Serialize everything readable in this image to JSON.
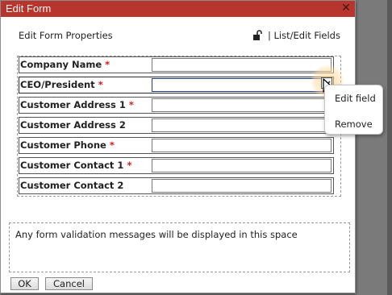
{
  "window": {
    "title": "Edit Form",
    "close_icon": "close-icon"
  },
  "header": {
    "properties_label": "Edit Form Properties",
    "lock_icon": "unlocked-padlock-icon",
    "list_edit_label": "| List/Edit Fields"
  },
  "fields": [
    {
      "label": "Company Name",
      "required": "*",
      "value": ""
    },
    {
      "label": "CEO/President",
      "required": "*",
      "value": "",
      "selected": true
    },
    {
      "label": "Customer Address 1",
      "required": "*",
      "value": ""
    },
    {
      "label": "Customer Address 2",
      "required": "",
      "value": ""
    },
    {
      "label": "Customer Phone",
      "required": "*",
      "value": ""
    },
    {
      "label": "Customer Contact 1",
      "required": "*",
      "value": ""
    },
    {
      "label": "Customer Contact 2",
      "required": "",
      "value": ""
    }
  ],
  "context_menu": {
    "items": [
      "Edit field",
      "Remove"
    ]
  },
  "validation": {
    "message": "Any form validation messages will be displayed in this space"
  },
  "buttons": {
    "ok": "OK",
    "cancel": "Cancel"
  },
  "colors": {
    "titlebar": "#b8352d",
    "required_asterisk": "#d02020",
    "selected_input_border": "#1f3a8a"
  }
}
